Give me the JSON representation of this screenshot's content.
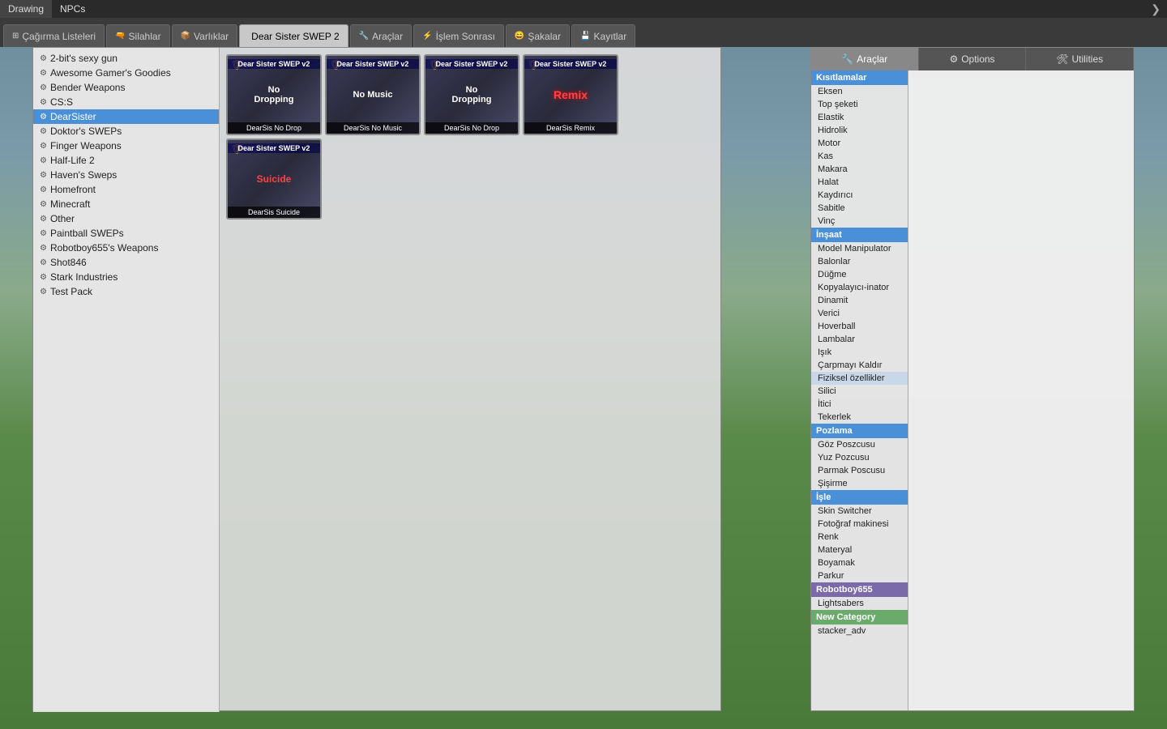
{
  "topMenu": {
    "items": [
      "Drawing",
      "NPCs"
    ],
    "arrow": "❯"
  },
  "tabs": [
    {
      "id": "cagirma",
      "label": "Çağırma Listeleri",
      "icon": "⊞"
    },
    {
      "id": "silahlar",
      "label": "Silahlar",
      "icon": "🔫",
      "active": true
    },
    {
      "id": "varliklar",
      "label": "Varlıklar",
      "icon": "📦"
    },
    {
      "id": "dear-sister",
      "label": "Dear Sister SWEP 2",
      "icon": "",
      "tabActive": true
    },
    {
      "id": "araclar-tab",
      "label": "Araçlar",
      "icon": "🔧"
    },
    {
      "id": "islem",
      "label": "İşlem Sonrası",
      "icon": "⚡"
    },
    {
      "id": "sakalar",
      "label": "Şakalar",
      "icon": "😄"
    },
    {
      "id": "kayitlar",
      "label": "Kayıtlar",
      "icon": "💾"
    }
  ],
  "sidebar": {
    "items": [
      {
        "label": "2-bit's sexy gun",
        "active": false
      },
      {
        "label": "Awesome Gamer's Goodies",
        "active": false
      },
      {
        "label": "Bender Weapons",
        "active": false
      },
      {
        "label": "CS:S",
        "active": false
      },
      {
        "label": "DearSister",
        "active": true
      },
      {
        "label": "Doktor's SWEPs",
        "active": false
      },
      {
        "label": "Finger Weapons",
        "active": false
      },
      {
        "label": "Half-Life 2",
        "active": false
      },
      {
        "label": "Haven's Sweps",
        "active": false
      },
      {
        "label": "Homefront",
        "active": false
      },
      {
        "label": "Minecraft",
        "active": false
      },
      {
        "label": "Other",
        "active": false
      },
      {
        "label": "Paintball SWEPs",
        "active": false
      },
      {
        "label": "Robotboy655's Weapons",
        "active": false
      },
      {
        "label": "Shot846",
        "active": false
      },
      {
        "label": "Stark Industries",
        "active": false
      },
      {
        "label": "Test Pack",
        "active": false
      }
    ]
  },
  "weaponCards": [
    {
      "id": 1,
      "title": "Dear Sister SWEP v2",
      "name": "DearSis No Drop",
      "overlay": "No Dropping",
      "overlayClass": "no-drop"
    },
    {
      "id": 2,
      "title": "Dear Sister SWEP v2",
      "name": "DearSis No Music",
      "overlay": "No Music",
      "overlayClass": "no-music"
    },
    {
      "id": 3,
      "title": "Dear Sister SWEP v2",
      "name": "DearSis No Drop",
      "overlay": "No Dropping",
      "overlayClass": "no-drop"
    },
    {
      "id": 4,
      "title": "Dear Sister SWEP v2",
      "name": "DearSis Remix",
      "overlay": "Remix",
      "overlayClass": "remix"
    },
    {
      "id": 5,
      "title": "Dear Sister SWEP v2",
      "name": "DearSis Suicide",
      "overlay": "Suicide",
      "overlayClass": "suicide"
    }
  ],
  "rightPanel": {
    "tabs": [
      {
        "label": "Araçlar",
        "icon": "🔧",
        "active": true
      },
      {
        "label": "Options",
        "icon": "⚙"
      },
      {
        "label": "Utilities",
        "icon": "🛠"
      }
    ]
  },
  "toolCategories": [
    {
      "label": "Kısıtlamalar",
      "items": [
        "Eksen",
        "Top şeketi",
        "Elastik",
        "Hidrolik",
        "Motor",
        "Kas",
        "Makara",
        "Halat",
        "Kaydırıcı",
        "Sabitle",
        "Vinç"
      ]
    },
    {
      "label": "İnşaat",
      "items": [
        "Model Manipulator",
        "Balonlar",
        "Düğme",
        "Kopyalayıcı-inator",
        "Dinamit",
        "Verici",
        "Hoverball",
        "Lambalar",
        "Işık",
        "Çarpmayı Kaldır",
        "Fiziksel özellikler",
        "Silici",
        "İtici",
        "Tekerlek"
      ]
    },
    {
      "label": "Pozlama",
      "items": [
        "Göz Poszcusu",
        "Yuz Pozcusu",
        "Parmak Poscusu",
        "Şişirme"
      ]
    },
    {
      "label": "İşle",
      "items": [
        "Skin Switcher",
        "Fotoğraf makinesi",
        "Renk",
        "Materyal",
        "Boyamak",
        "Parkur"
      ]
    },
    {
      "label": "Robotboy655",
      "items": [
        "Lightsabers"
      ]
    },
    {
      "label": "New Category",
      "items": [
        "stacker_adv"
      ]
    }
  ]
}
